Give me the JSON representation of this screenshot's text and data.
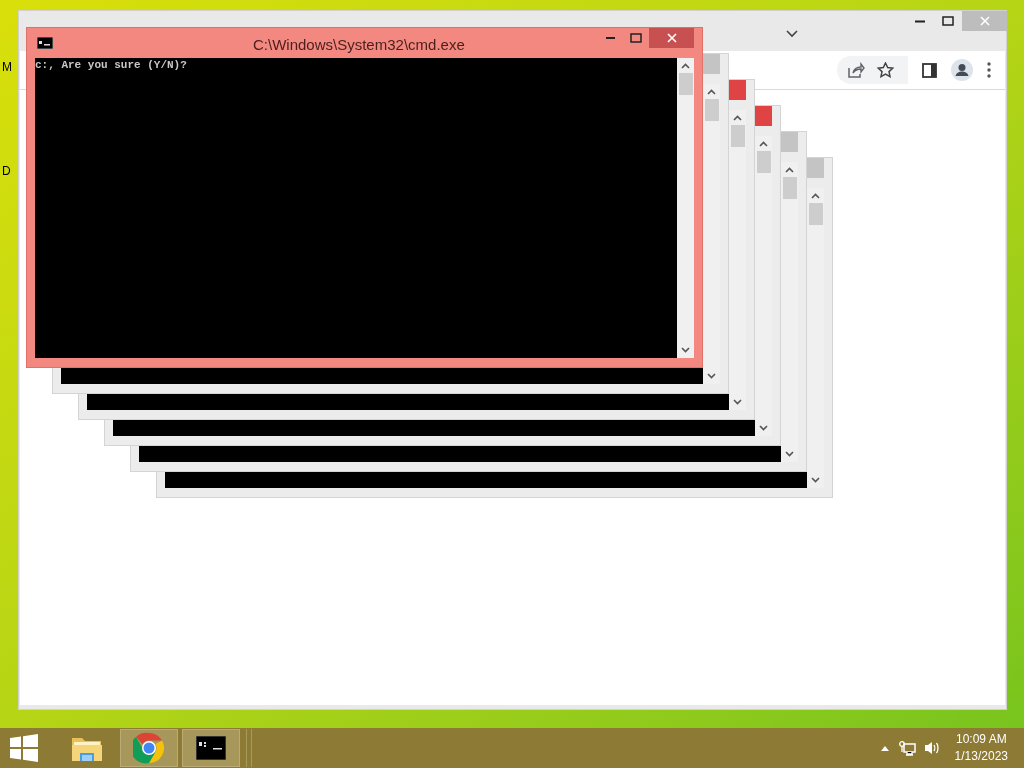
{
  "desktop": {
    "icon_labels": [
      "M",
      "D"
    ]
  },
  "background_windows": [
    {
      "close_hover": false
    },
    {
      "close_hover": true
    },
    {
      "close_hover": true
    },
    {
      "close_hover": false
    },
    {
      "close_hover": false
    }
  ],
  "console_window": {
    "title": "C:\\Windows\\System32\\cmd.exe",
    "active": true,
    "lines": [
      "c:, Are you sure (Y/N)?"
    ]
  },
  "taskbar": {
    "items": [
      {
        "kind": "explorer",
        "active": false
      },
      {
        "kind": "chrome",
        "active": true
      },
      {
        "kind": "cmd",
        "active": true
      }
    ],
    "clock": {
      "time": "10:09 AM",
      "date": "1/13/2023"
    }
  }
}
